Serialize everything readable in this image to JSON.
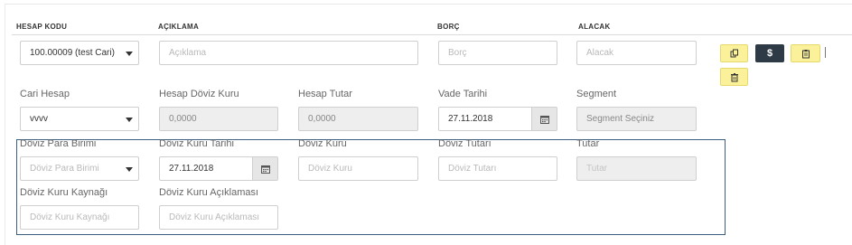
{
  "headers": {
    "hesap_kodu": "HESAP KODU",
    "aciklama": "AÇIKLAMA",
    "borc": "BORÇ",
    "alacak": "ALACAK"
  },
  "row1": {
    "hesap_kodu_value": "100.00009 (test Cari)",
    "aciklama_placeholder": "Açıklama",
    "borc_placeholder": "Borç",
    "alacak_placeholder": "Alacak"
  },
  "actions": {
    "dollar_label": "$"
  },
  "section1": {
    "cari_hesap": {
      "label": "Cari Hesap",
      "value": "vvvv"
    },
    "hesap_doviz_kuru": {
      "label": "Hesap Döviz Kuru",
      "value": "0,0000"
    },
    "hesap_tutar": {
      "label": "Hesap Tutar",
      "value": "0,0000"
    },
    "vade_tarihi": {
      "label": "Vade Tarihi",
      "value": "27.11.2018"
    },
    "segment": {
      "label": "Segment",
      "value": "Segment Seçiniz"
    }
  },
  "section2": {
    "doviz_para_birimi": {
      "label": "Döviz Para Birimi",
      "placeholder": "Döviz Para Birimi"
    },
    "doviz_kuru_tarihi": {
      "label": "Döviz Kuru Tarihi",
      "value": "27.11.2018"
    },
    "doviz_kuru": {
      "label": "Döviz Kuru",
      "placeholder": "Döviz Kuru"
    },
    "doviz_tutari": {
      "label": "Döviz Tutarı",
      "placeholder": "Döviz Tutarı"
    },
    "tutar": {
      "label": "Tutar",
      "placeholder": "Tutar"
    },
    "doviz_kuru_kaynagi": {
      "label": "Döviz Kuru Kaynağı",
      "placeholder": "Döviz Kuru Kaynağı"
    },
    "doviz_kuru_aciklamasi": {
      "label": "Döviz Kuru Açıklaması",
      "placeholder": "Döviz Kuru Açıklaması"
    }
  },
  "icons": [
    "copy-icon",
    "dollar-icon",
    "clipboard-icon",
    "trash-icon",
    "calendar-icon",
    "chevron-down-icon"
  ]
}
